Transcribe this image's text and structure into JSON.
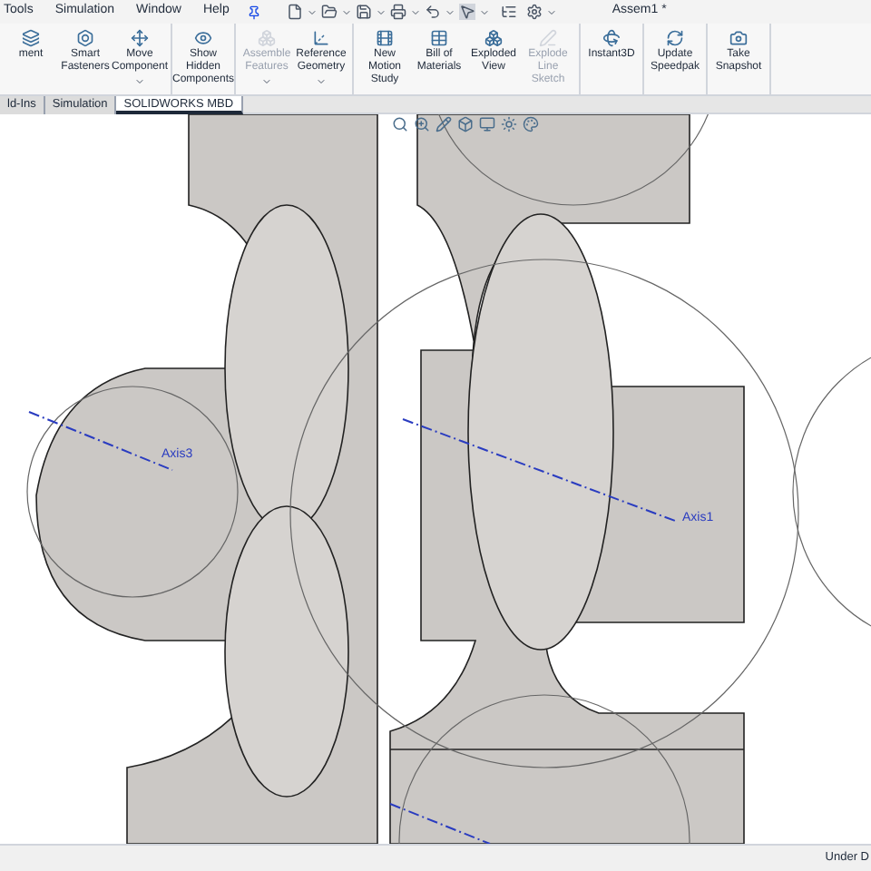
{
  "menu_bar": {
    "items": [
      {
        "label": "Tools"
      },
      {
        "label": "Simulation"
      },
      {
        "label": "Window"
      },
      {
        "label": "Help"
      }
    ],
    "title": "Assem1 *"
  },
  "ribbon": {
    "groups": [
      [
        {
          "label": "ment",
          "disabled": false,
          "dropdown": false
        },
        {
          "label": "Smart Fasteners",
          "disabled": false,
          "dropdown": false
        },
        {
          "label": "Move Component",
          "disabled": false,
          "dropdown": true
        }
      ],
      [
        {
          "label": "Show Hidden Components",
          "disabled": false,
          "dropdown": false
        }
      ],
      [
        {
          "label": "Assemble Features",
          "disabled": true,
          "dropdown": true
        },
        {
          "label": "Reference Geometry",
          "disabled": false,
          "dropdown": true
        }
      ],
      [
        {
          "label": "New Motion Study",
          "disabled": false,
          "dropdown": false
        },
        {
          "label": "Bill of Materials",
          "disabled": false,
          "dropdown": false
        },
        {
          "label": "Exploded View",
          "disabled": false,
          "dropdown": false
        },
        {
          "label": "Explode Line Sketch",
          "disabled": true,
          "dropdown": false
        }
      ],
      [
        {
          "label": "Instant3D",
          "disabled": false,
          "dropdown": false
        }
      ],
      [
        {
          "label": "Update Speedpak",
          "disabled": false,
          "dropdown": false
        }
      ],
      [
        {
          "label": "Take Snapshot",
          "disabled": false,
          "dropdown": false
        }
      ]
    ]
  },
  "tabs": [
    {
      "label": "ld-Ins",
      "selected": false
    },
    {
      "label": "Simulation",
      "selected": false
    },
    {
      "label": "SOLIDWORKS MBD",
      "selected": true
    }
  ],
  "viewport": {
    "axes": [
      {
        "label": "Axis3"
      },
      {
        "label": "Axis1"
      }
    ]
  },
  "status_bar": {
    "text": "Under D"
  }
}
